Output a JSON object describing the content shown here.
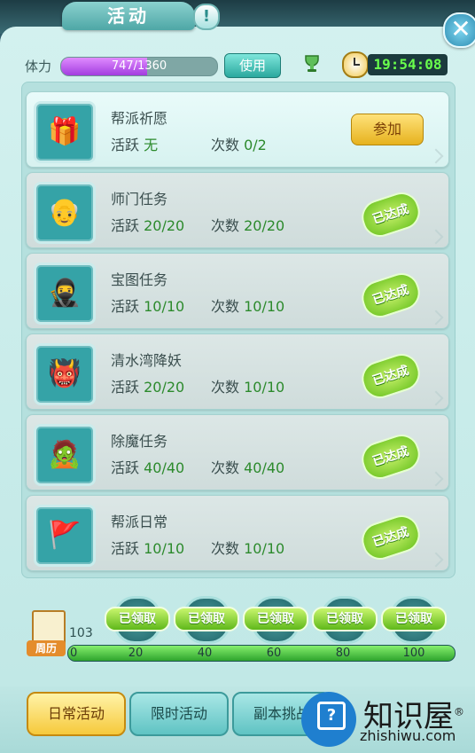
{
  "window": {
    "title": "活动",
    "info": "!",
    "close": "✕"
  },
  "stamina": {
    "label": "体力",
    "current": 747,
    "max": 1360,
    "display": "747/1360",
    "use_button": "使用"
  },
  "clock": {
    "time": "19:54:08"
  },
  "activities": [
    {
      "title": "帮派祈愿",
      "active_label": "活跃",
      "active_value": "无",
      "count_label": "次数",
      "count_value": "0/2",
      "state": "join",
      "join_label": "参加",
      "icon": "gift-box-icon"
    },
    {
      "title": "师门任务",
      "active_label": "活跃",
      "active_value": "20/20",
      "count_label": "次数",
      "count_value": "20/20",
      "state": "done",
      "done_label": "已达成",
      "icon": "elder-master-avatar-icon"
    },
    {
      "title": "宝图任务",
      "active_label": "活跃",
      "active_value": "10/10",
      "count_label": "次数",
      "count_value": "10/10",
      "state": "done",
      "done_label": "已达成",
      "icon": "ninja-avatar-icon"
    },
    {
      "title": "清水湾降妖",
      "active_label": "活跃",
      "active_value": "20/20",
      "count_label": "次数",
      "count_value": "10/10",
      "state": "done",
      "done_label": "已达成",
      "icon": "demon-avatar-icon"
    },
    {
      "title": "除魔任务",
      "active_label": "活跃",
      "active_value": "40/40",
      "count_label": "次数",
      "count_value": "40/40",
      "state": "done",
      "done_label": "已达成",
      "icon": "ghost-official-avatar-icon"
    },
    {
      "title": "帮派日常",
      "active_label": "活跃",
      "active_value": "10/10",
      "count_label": "次数",
      "count_value": "10/10",
      "state": "done",
      "done_label": "已达成",
      "icon": "guild-banner-icon"
    }
  ],
  "weekly": {
    "calendar_label": "周历",
    "points": "103",
    "progress_fraction": 1.0,
    "ticks": [
      "0",
      "20",
      "40",
      "60",
      "80",
      "100"
    ],
    "rewards": [
      "已领取",
      "已领取",
      "已领取",
      "已领取",
      "已领取"
    ]
  },
  "tabs": [
    {
      "label": "日常活动",
      "active": true
    },
    {
      "label": "限时活动",
      "active": false
    },
    {
      "label": "副本挑战",
      "active": false
    }
  ],
  "watermark": {
    "brand": "知识屋",
    "domain": "zhishiwu.com",
    "reg": "®"
  },
  "colors": {
    "accent": "#2c8a2c",
    "join": "#f2c230",
    "done": "#66c11c"
  }
}
